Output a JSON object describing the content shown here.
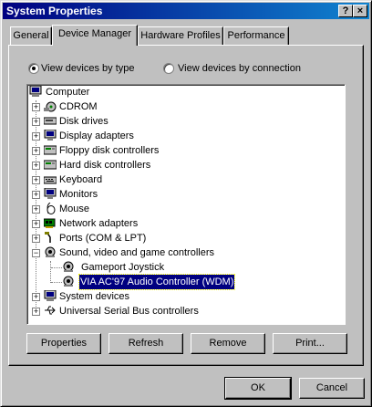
{
  "window": {
    "title": "System Properties",
    "help_glyph": "?",
    "close_glyph": "×"
  },
  "tabs": [
    "General",
    "Device Manager",
    "Hardware Profiles",
    "Performance"
  ],
  "view": {
    "by_type": "View devices by type",
    "by_connection": "View devices by connection",
    "selected": "by_type"
  },
  "tree": {
    "root": "Computer",
    "items": [
      {
        "label": "CDROM",
        "icon": "cdrom-icon"
      },
      {
        "label": "Disk drives",
        "icon": "disk-drive-icon"
      },
      {
        "label": "Display adapters",
        "icon": "monitor-icon"
      },
      {
        "label": "Floppy disk controllers",
        "icon": "floppy-controller-icon"
      },
      {
        "label": "Hard disk controllers",
        "icon": "hard-disk-controller-icon"
      },
      {
        "label": "Keyboard",
        "icon": "keyboard-icon"
      },
      {
        "label": "Monitors",
        "icon": "monitor-icon"
      },
      {
        "label": "Mouse",
        "icon": "mouse-icon"
      },
      {
        "label": "Network adapters",
        "icon": "network-adapter-icon"
      },
      {
        "label": "Ports (COM & LPT)",
        "icon": "port-icon"
      },
      {
        "label": "Sound, video and game controllers",
        "icon": "sound-icon",
        "expanded": true,
        "children": [
          "Gameport Joystick",
          "VIA AC'97 Audio Controller (WDM)"
        ]
      },
      {
        "label": "System devices",
        "icon": "system-devices-icon"
      },
      {
        "label": "Universal Serial Bus controllers",
        "icon": "usb-icon"
      }
    ],
    "selected": "VIA AC'97 Audio Controller (WDM)"
  },
  "buttons": {
    "properties": "Properties",
    "refresh": "Refresh",
    "remove": "Remove",
    "print": "Print..."
  },
  "footer": {
    "ok": "OK",
    "cancel": "Cancel"
  }
}
